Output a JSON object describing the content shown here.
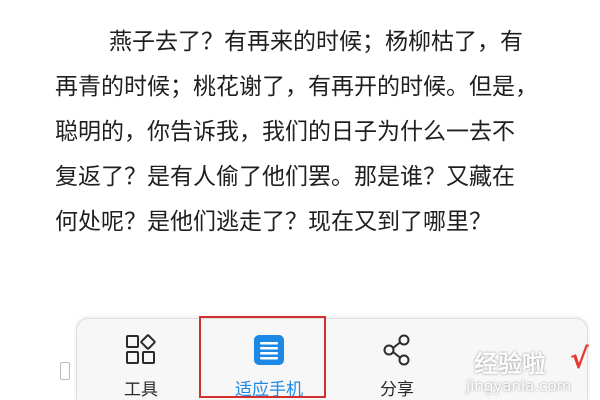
{
  "article": {
    "lines": [
      "燕子去了？有再来的时候；杨柳枯了，有",
      "再青的时候；桃花谢了，有再开的时候。但是，",
      "聪明的，你告诉我，我们的日子为什么一去不",
      "复返了？是有人偷了他们罢。那是谁？又藏在",
      "何处呢？是他们逃走了？现在又到了哪里？"
    ]
  },
  "toolbar": {
    "tools_label": "工具",
    "fit_phone_label": "适应手机",
    "share_label": "分享"
  },
  "watermark": {
    "brand_text": "经验啦",
    "check_mark": "√",
    "url_text": "jingyanla.com"
  },
  "colors": {
    "active_blue": "#1e88e5",
    "highlight_red": "#d32f2f",
    "text_dark": "#1f1f1f"
  }
}
